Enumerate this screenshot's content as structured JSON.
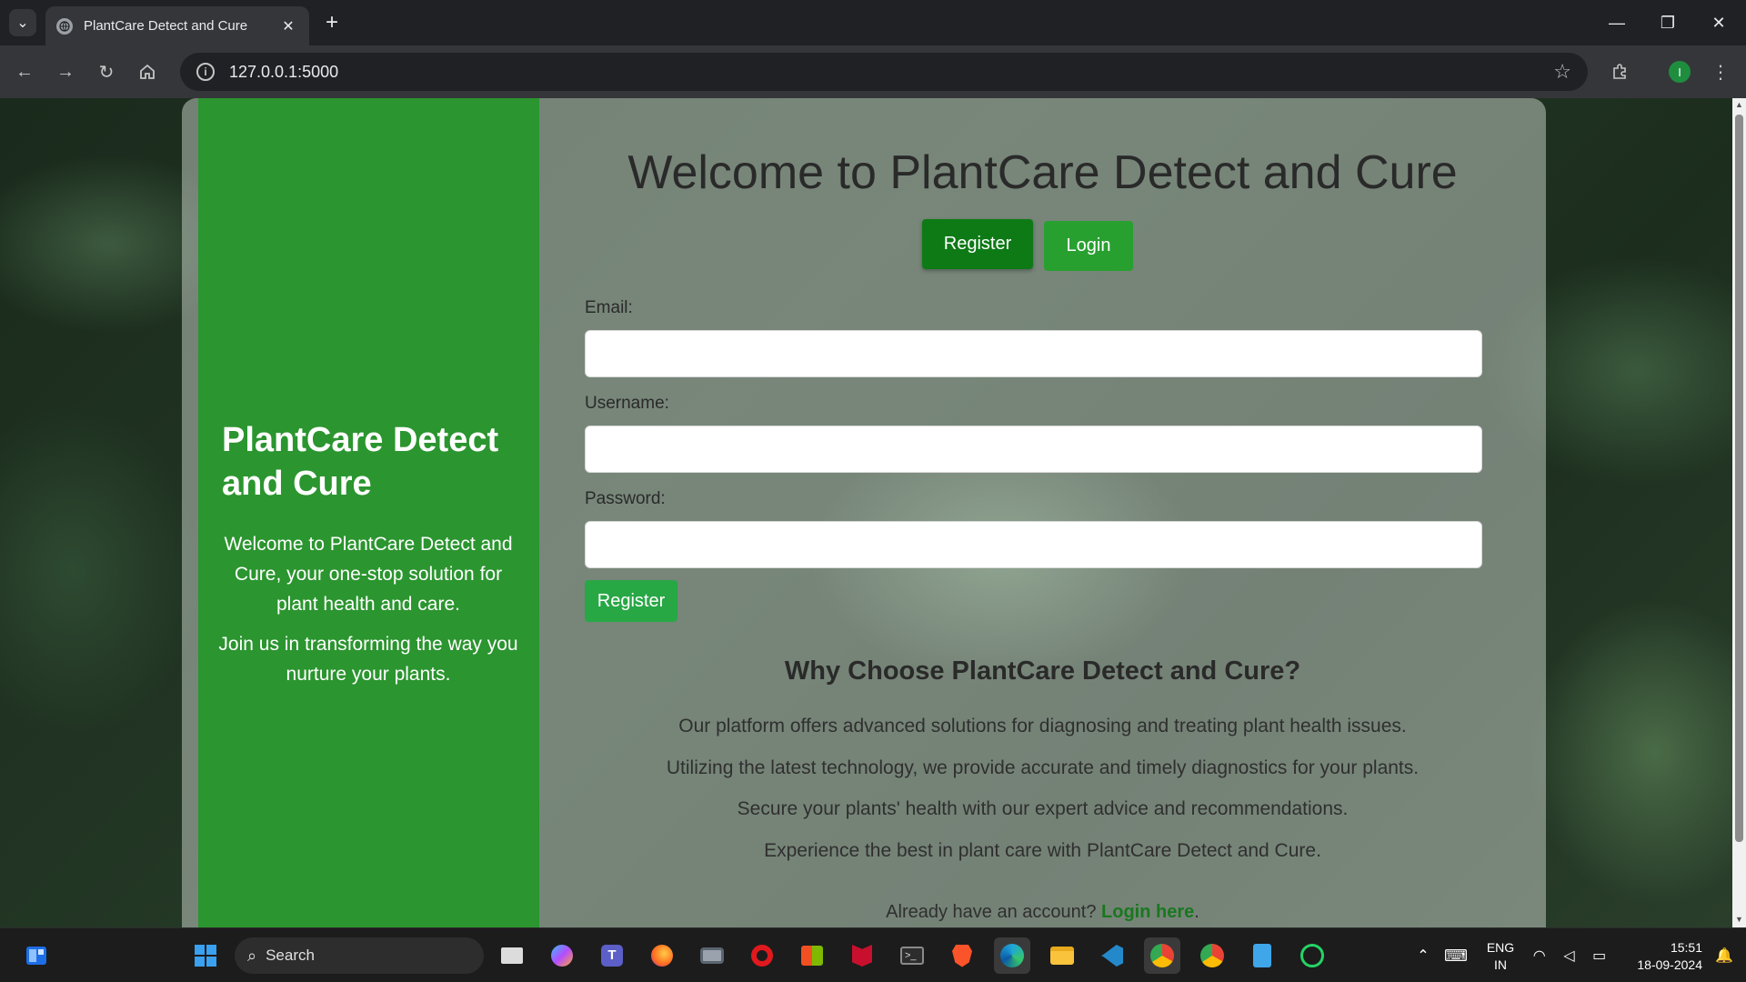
{
  "browser": {
    "tab_title": "PlantCare Detect and Cure",
    "tab_close": "✕",
    "new_tab": "+",
    "url": "127.0.0.1:5000",
    "profile_initial": "I"
  },
  "sidebar": {
    "title": "PlantCare Detect and Cure",
    "intro": "Welcome to PlantCare Detect and Cure, your one-stop solution for plant health and care.",
    "join": "Join us in transforming the way you nurture your plants."
  },
  "main": {
    "heading": "Welcome to PlantCare Detect and Cure",
    "register_tab": "Register",
    "login_tab": "Login",
    "form": {
      "email_label": "Email:",
      "email_value": "",
      "username_label": "Username:",
      "username_value": "",
      "password_label": "Password:",
      "password_value": "",
      "submit_label": "Register"
    },
    "why": {
      "title": "Why Choose PlantCare Detect and Cure?",
      "lines": [
        "Our platform offers advanced solutions for diagnosing and treating plant health issues.",
        "Utilizing the latest technology, we provide accurate and timely diagnostics for your plants.",
        "Secure your plants' health with our expert advice and recommendations.",
        "Experience the best in plant care with PlantCare Detect and Cure."
      ]
    },
    "footer": {
      "prefix": "Already have an account?",
      "link": "Login here",
      "suffix": "."
    }
  },
  "taskbar": {
    "search_placeholder": "Search",
    "lang_top": "ENG",
    "lang_bottom": "IN",
    "time": "15:51",
    "date": "18-09-2024",
    "apps": [
      "file-explorer-icon",
      "copilot-icon",
      "teams-icon",
      "firefox-icon",
      "camera-icon",
      "opera-icon",
      "store-icon",
      "mcafee-icon",
      "terminal-icon",
      "brave-icon",
      "edge-icon",
      "folder-icon",
      "vscode-icon",
      "chrome-icon",
      "chrome-profile-icon",
      "notepad-icon",
      "whatsapp-icon"
    ]
  },
  "colors": {
    "sidebar_green": "#2b952f",
    "register_dark_green": "#0d7a16",
    "login_green": "#28a030",
    "submit_green": "#28a745",
    "link_green": "#19781f"
  }
}
